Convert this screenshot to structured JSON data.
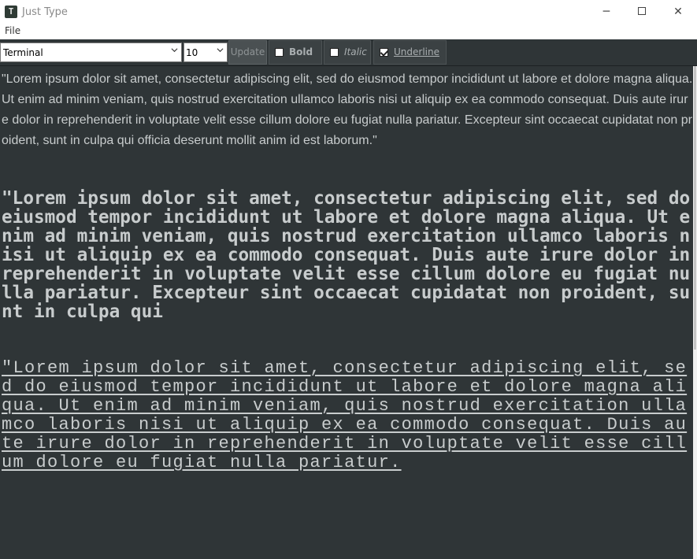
{
  "window": {
    "title": "Just Type",
    "icon": "app-icon",
    "controls": {
      "minimize": "─",
      "close": "✕"
    }
  },
  "menu": {
    "file": "File"
  },
  "toolbar": {
    "font_name": "Terminal",
    "font_size": "10",
    "update_label": "Update",
    "bold": {
      "label": "Bold",
      "checked": false
    },
    "italic": {
      "label": "Italic",
      "checked": false
    },
    "underline": {
      "label": "Underline",
      "checked": true
    }
  },
  "content": {
    "p1": "\"Lorem ipsum dolor sit amet, consectetur adipiscing elit, sed do eiusmod tempor incididunt ut labore et dolore magna aliqua. Ut enim ad minim veniam, quis nostrud exercitation ullamco laboris nisi ut aliquip ex ea commodo consequat. Duis aute irure dolor in reprehenderit in voluptate velit esse cillum dolore eu fugiat nulla pariatur. Excepteur sint occaecat cupidatat non proident, sunt in culpa qui officia deserunt mollit anim id est laborum.\"",
    "p2": "\"Lorem ipsum dolor sit amet, consectetur adipiscing elit, sed do eiusmod tempor incididunt ut labore et dolore magna aliqua. Ut enim ad minim veniam, quis nostrud exercitation ullamco laboris nisi ut aliquip ex ea commodo consequat. Duis aute irure dolor in reprehenderit in voluptate velit esse cillum dolore eu fugiat nulla pariatur. Excepteur sint occaecat cupidatat non proident, sunt in culpa qui",
    "p3": "\"Lorem ipsum dolor sit amet, consectetur adipiscing elit, sed do eiusmod tempor incididunt ut labore et dolore magna aliqua. Ut enim ad minim veniam, quis nostrud exercitation ullamco laboris nisi ut aliquip ex ea commodo consequat. Duis aute irure dolor in reprehenderit in voluptate velit esse cillum dolore eu fugiat nulla pariatur."
  },
  "colors": {
    "editor_bg": "#2f3537",
    "text": "#c8cccd",
    "toolbar_bg": "#2f3537"
  }
}
